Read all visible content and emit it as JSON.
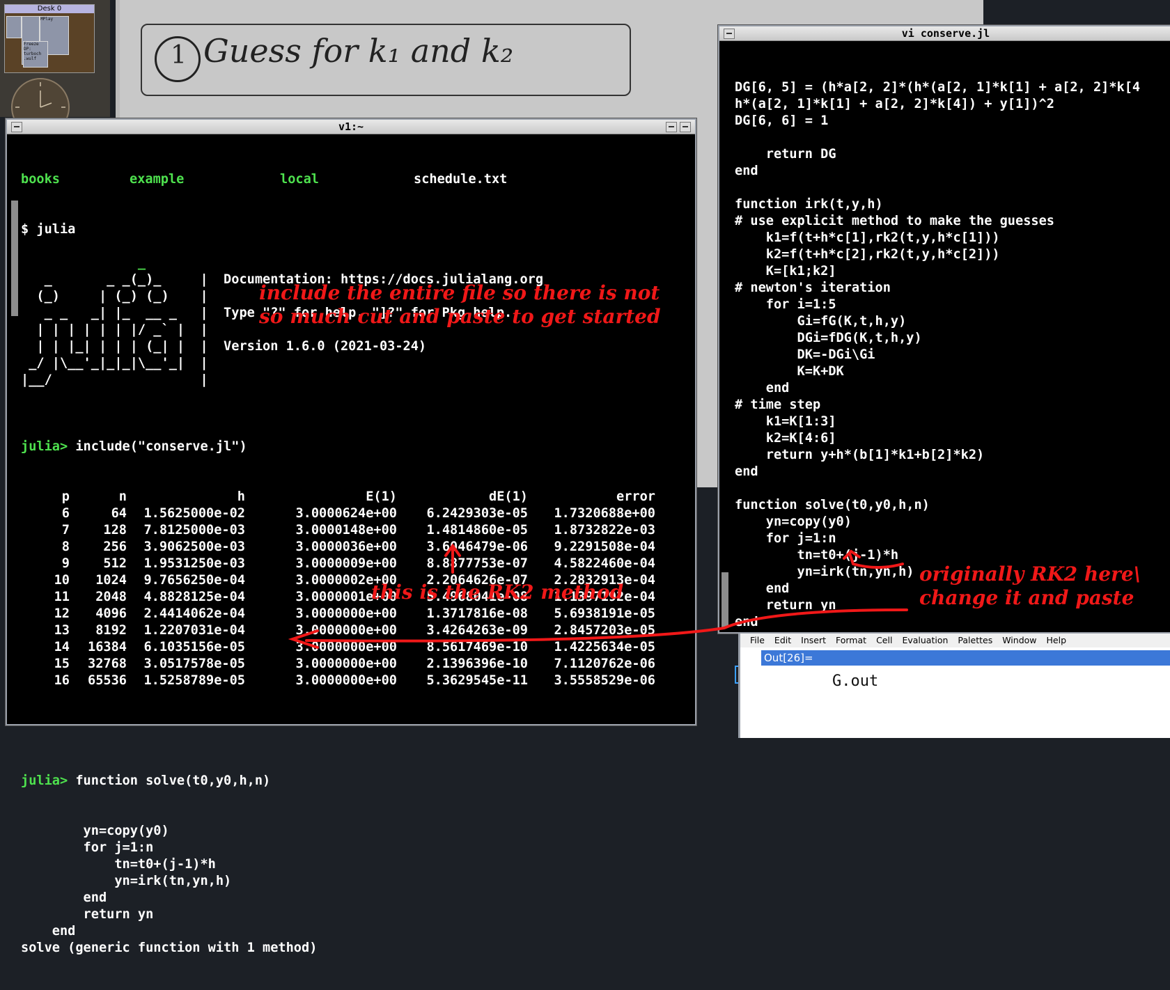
{
  "pager": {
    "desk_label": "Desk 0",
    "mini_texts": [
      "MPlay",
      "Freeze",
      "DP:",
      "turboch",
      ".wulf"
    ]
  },
  "background_note": {
    "handwriting": "Guess for  k₁  and  k₂",
    "circled_number": "1"
  },
  "left_window": {
    "title": "v1:~",
    "dir_listing": [
      "books",
      "example",
      "local",
      "schedule.txt"
    ],
    "lines": [
      {
        "text": "$ julia",
        "cls": ""
      },
      {
        "text": "",
        "cls": ""
      },
      {
        "text": "               _",
        "cls": "green"
      },
      {
        "text": "   _       _ _(_)_     |  Documentation: https://docs.julialang.org",
        "cls": ""
      },
      {
        "text": "  (_)     | (_) (_)    |",
        "cls": ""
      },
      {
        "text": "   _ _   _| |_  __ _   |  Type \"?\" for help, \"]?\" for Pkg help.",
        "cls": ""
      },
      {
        "text": "  | | | | | | |/ _` |  |",
        "cls": ""
      },
      {
        "text": "  | | |_| | | | (_| |  |  Version 1.6.0 (2021-03-24)",
        "cls": ""
      },
      {
        "text": " _/ |\\__'_|_|_|\\__'_|  |",
        "cls": ""
      },
      {
        "text": "|__/                   |",
        "cls": ""
      },
      {
        "text": "",
        "cls": ""
      }
    ],
    "prompt": "julia>",
    "include_cmd": " include(\"conserve.jl\")",
    "table_header": [
      "p",
      "n",
      "h",
      "E(1)",
      "dE(1)",
      "error"
    ],
    "table_rows": [
      [
        "6",
        "64",
        "1.5625000e-02",
        "3.0000624e+00",
        "6.2429303e-05",
        "1.7320688e+00"
      ],
      [
        "7",
        "128",
        "7.8125000e-03",
        "3.0000148e+00",
        "1.4814860e-05",
        "1.8732822e-03"
      ],
      [
        "8",
        "256",
        "3.9062500e-03",
        "3.0000036e+00",
        "3.6046479e-06",
        "9.2291508e-04"
      ],
      [
        "9",
        "512",
        "1.9531250e-03",
        "3.0000009e+00",
        "8.8877753e-07",
        "4.5822460e-04"
      ],
      [
        "10",
        "1024",
        "9.7656250e-04",
        "3.0000002e+00",
        "2.2064626e-07",
        "2.2832913e-04"
      ],
      [
        "11",
        "2048",
        "4.8828125e-04",
        "3.0000001e+00",
        "5.4968041e-08",
        "1.1397192e-04"
      ],
      [
        "12",
        "4096",
        "2.4414062e-04",
        "3.0000000e+00",
        "1.3717816e-08",
        "5.6938191e-05"
      ],
      [
        "13",
        "8192",
        "1.2207031e-04",
        "3.0000000e+00",
        "3.4264263e-09",
        "2.8457203e-05"
      ],
      [
        "14",
        "16384",
        "6.1035156e-05",
        "3.0000000e+00",
        "8.5617469e-10",
        "1.4225634e-05"
      ],
      [
        "15",
        "32768",
        "3.0517578e-05",
        "3.0000000e+00",
        "2.1396396e-10",
        "7.1120762e-06"
      ],
      [
        "16",
        "65536",
        "1.5258789e-05",
        "3.0000000e+00",
        "5.3629545e-11",
        "3.5558529e-06"
      ]
    ],
    "solve_cmd": " function solve(t0,y0,h,n)",
    "solve_body": [
      "        yn=copy(y0)",
      "        for j=1:n",
      "            tn=t0+(j-1)*h",
      "            yn=irk(tn,yn,h)",
      "        end",
      "        return yn",
      "    end",
      "solve (generic function with 1 method)"
    ]
  },
  "right_window": {
    "title": "vi conserve.jl",
    "lines": [
      "DG[6, 5] = (h*a[2, 2]*(h*(a[2, 1]*k[1] + a[2, 2]*k[4",
      "h*(a[2, 1]*k[1] + a[2, 2]*k[4]) + y[1])^2",
      "DG[6, 6] = 1",
      "",
      "    return DG",
      "end",
      "",
      "function irk(t,y,h)",
      "# use explicit method to make the guesses",
      "    k1=f(t+h*c[1],rk2(t,y,h*c[1]))",
      "    k2=f(t+h*c[2],rk2(t,y,h*c[2]))",
      "    K=[k1;k2]",
      "# newton's iteration",
      "    for i=1:5",
      "        Gi=fG(K,t,h,y)",
      "        DGi=fDG(K,t,h,y)",
      "        DK=-DGi\\Gi",
      "        K=K+DK",
      "    end",
      "# time step",
      "    k1=K[1:3]",
      "    k2=K[4:6]",
      "    return y+h*(b[1]*k1+b[2]*k2)",
      "end",
      "",
      "function solve(t0,y0,h,n)",
      "    yn=copy(y0)",
      "    for j=1:n",
      "        tn=t0+(j-1)*h",
      "        yn=irk(tn,yn,h)",
      "    end",
      "    return yn",
      "end"
    ]
  },
  "annotations": {
    "include_note": "include the entire file so there is not\nso much cut and paste to get started",
    "rk2_note": "this is the RK2 method",
    "orig_note": "originally RK2 here\\\nchange it and paste"
  },
  "mathematica": {
    "menu": [
      "File",
      "Edit",
      "Insert",
      "Format",
      "Cell",
      "Evaluation",
      "Palettes",
      "Window",
      "Help"
    ],
    "out_label": "Out[26]=",
    "g_out": "G.out"
  },
  "colors": {
    "annotation": "#f01818",
    "prompt": "#4ee14e",
    "terminal_bg": "#000000"
  }
}
